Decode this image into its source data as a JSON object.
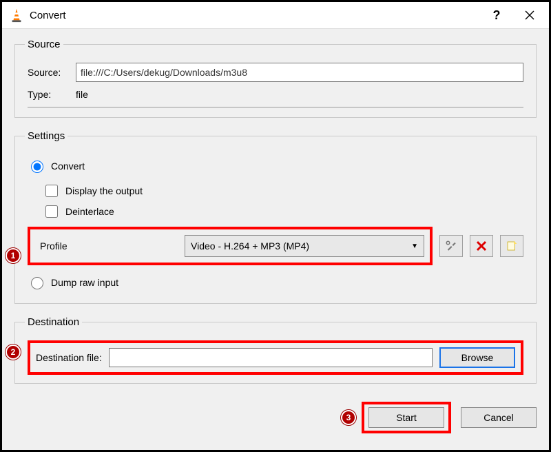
{
  "window": {
    "title": "Convert",
    "help": "?",
    "close": "×"
  },
  "source": {
    "legend": "Source",
    "sourceLabel": "Source:",
    "sourceValue": "file:///C:/Users/dekug/Downloads/m3u8",
    "typeLabel": "Type:",
    "typeValue": "file"
  },
  "settings": {
    "legend": "Settings",
    "convertLabel": "Convert",
    "displayOutputLabel": "Display the output",
    "deinterlaceLabel": "Deinterlace",
    "profileLabel": "Profile",
    "profileValue": "Video - H.264 + MP3 (MP4)",
    "dumpRawLabel": "Dump raw input"
  },
  "destination": {
    "legend": "Destination",
    "label": "Destination file:",
    "value": "",
    "browseLabel": "Browse"
  },
  "footer": {
    "startLabel": "Start",
    "cancelLabel": "Cancel"
  },
  "callouts": {
    "one": "1",
    "two": "2",
    "three": "3"
  }
}
